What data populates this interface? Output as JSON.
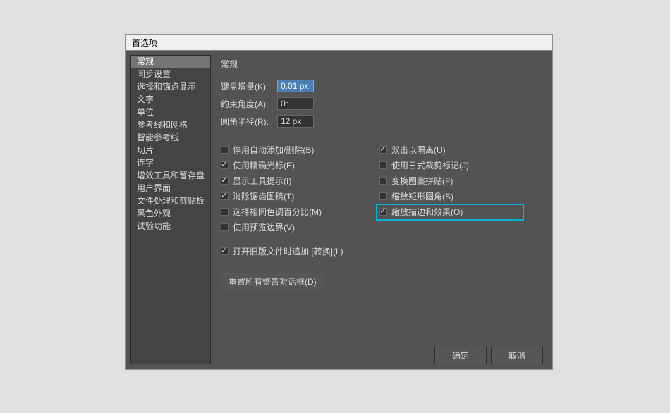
{
  "dialog": {
    "title": "首选项",
    "section_title": "常规",
    "sidebar": {
      "items": [
        {
          "label": "常规",
          "selected": true
        },
        {
          "label": "同步设置",
          "selected": false
        },
        {
          "label": "选择和锚点显示",
          "selected": false
        },
        {
          "label": "文字",
          "selected": false
        },
        {
          "label": "单位",
          "selected": false
        },
        {
          "label": "参考线和网格",
          "selected": false
        },
        {
          "label": "智能参考线",
          "selected": false
        },
        {
          "label": "切片",
          "selected": false
        },
        {
          "label": "连字",
          "selected": false
        },
        {
          "label": "增效工具和暂存盘",
          "selected": false
        },
        {
          "label": "用户界面",
          "selected": false
        },
        {
          "label": "文件处理和剪贴板",
          "selected": false
        },
        {
          "label": "黑色外观",
          "selected": false
        },
        {
          "label": "试验功能",
          "selected": false
        }
      ]
    },
    "fields": {
      "keyboard_increment": {
        "label": "键盘增量(K):",
        "value": "0.01 px",
        "highlighted": true
      },
      "constrain_angle": {
        "label": "约束角度(A):",
        "value": "0°",
        "highlighted": false
      },
      "corner_radius": {
        "label": "圆角半径(R):",
        "value": "12 px",
        "highlighted": false
      }
    },
    "checkboxes": {
      "left": [
        {
          "label": "停用自动添加/删除(B)",
          "checked": false
        },
        {
          "label": "使用精确光标(E)",
          "checked": true
        },
        {
          "label": "显示工具提示(I)",
          "checked": true
        },
        {
          "label": "消除锯齿图稿(T)",
          "checked": true
        },
        {
          "label": "选择相同色调百分比(M)",
          "checked": false
        },
        {
          "label": "使用预览边界(V)",
          "checked": false
        }
      ],
      "right": [
        {
          "label": "双击以隔离(U)",
          "checked": true
        },
        {
          "label": "使用日式裁剪标记(J)",
          "checked": false
        },
        {
          "label": "变换图案拼贴(F)",
          "checked": false
        },
        {
          "label": "缩放矩形圆角(S)",
          "checked": false
        },
        {
          "label": "缩放描边和效果(O)",
          "checked": true,
          "highlighted": true
        }
      ]
    },
    "append_transform": {
      "label": "打开旧版文件时追加 [转换](L)",
      "checked": true
    },
    "reset_button": "重置所有警告对话框(D)",
    "buttons": {
      "ok": "确定",
      "cancel": "取消"
    }
  }
}
